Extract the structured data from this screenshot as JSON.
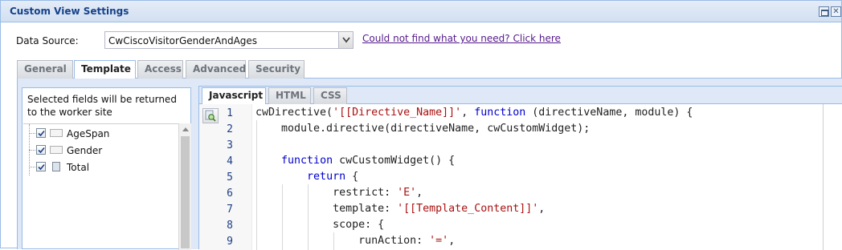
{
  "window": {
    "title": "Custom View Settings"
  },
  "data_source": {
    "label": "Data Source:",
    "value": "CwCiscoVisitorGenderAndAges",
    "help_link": "Could not find what you need? Click here"
  },
  "tabs": [
    {
      "label": "General",
      "active": false
    },
    {
      "label": "Template",
      "active": true
    },
    {
      "label": "Access",
      "active": false
    },
    {
      "label": "Advanced",
      "active": false
    },
    {
      "label": "Security",
      "active": false
    }
  ],
  "fields_panel": {
    "description": "Selected fields will be returned to the worker site",
    "fields": [
      {
        "label": "AgeSpan",
        "checked": true,
        "icon": "text-field-icon"
      },
      {
        "label": "Gender",
        "checked": true,
        "icon": "text-field-icon"
      },
      {
        "label": "Total",
        "checked": true,
        "icon": "calculator-icon"
      }
    ]
  },
  "editor": {
    "tabs": [
      {
        "label": "Javascript",
        "active": true
      },
      {
        "label": "HTML",
        "active": false
      },
      {
        "label": "CSS",
        "active": false
      }
    ],
    "line_numbers": [
      "1",
      "2",
      "3",
      "4",
      "5",
      "6",
      "7",
      "8",
      "9"
    ],
    "code_lines": [
      "cwDirective('[[Directive_Name]]', function (directiveName, module) {",
      "    module.directive(directiveName, cwCustomWidget);",
      "",
      "    function cwCustomWidget() {",
      "        return {",
      "            restrict: 'E',",
      "            template: '[[Template_Content]]',",
      "            scope: {",
      "                runAction: '=',"
    ],
    "colors": {
      "keyword": "#0000cc",
      "string": "#aa1111",
      "line_number": "#1d3f87"
    }
  }
}
